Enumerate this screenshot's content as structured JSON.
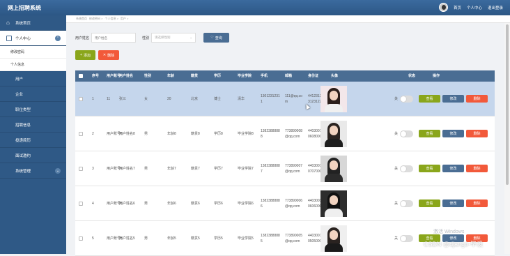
{
  "app": {
    "title": "网上招聘系统"
  },
  "topbar": {
    "avatar": "user-avatar",
    "links": [
      "首页",
      "个人中心",
      "退出登录"
    ]
  },
  "sidebar": {
    "items": [
      {
        "label": "系统首页",
        "icon": "home-icon",
        "type": "main"
      },
      {
        "label": "个人中心",
        "icon": "user-card-icon",
        "type": "main-light",
        "expanded": true
      },
      {
        "label": "修改密码",
        "type": "sub"
      },
      {
        "label": "个人信息",
        "type": "sub"
      },
      {
        "label": "用户",
        "icon": "grid-icon",
        "type": "main"
      },
      {
        "label": "企业",
        "icon": "grid-icon",
        "type": "main"
      },
      {
        "label": "职位类型",
        "icon": "grid-icon",
        "type": "main"
      },
      {
        "label": "招聘信息",
        "icon": "grid-icon",
        "type": "main"
      },
      {
        "label": "投递简历",
        "icon": "grid-icon",
        "type": "main"
      },
      {
        "label": "面试邀约",
        "icon": "grid-icon",
        "type": "main"
      },
      {
        "label": "系统管理",
        "icon": "grid-icon",
        "type": "main",
        "collapsible": true
      }
    ]
  },
  "breadcrumb": [
    "系统首页",
    "修改密码 >",
    "个人信息 >",
    "用户 >"
  ],
  "search": {
    "account_label": "用户姓名",
    "account_placeholder": "用户姓名",
    "gender_label": "性别",
    "gender_placeholder": "请选择性别",
    "button": "查询"
  },
  "actions": {
    "add": "添加",
    "delete": "删除"
  },
  "table": {
    "headers": [
      "序号",
      "用户账号",
      "用户姓名",
      "性别",
      "年龄",
      "籍贯",
      "学历",
      "毕业学院",
      "手机",
      "邮箱",
      "身份证",
      "头像",
      "状态",
      "操作"
    ],
    "status_label": "关",
    "buttons": {
      "view": "查看",
      "edit": "修改",
      "delete": "删除"
    },
    "rows": [
      {
        "no": "1",
        "account": "11",
        "name": "张三",
        "gender": "女",
        "age": "20",
        "origin": "北京",
        "edu": "博士",
        "school": "清华",
        "phone": "13012312311",
        "email": "111@qq.com",
        "idcard": "441231231231231223",
        "bg": "#f3e7ea",
        "hair": "#2b1e1a",
        "body": "#f0f0f0",
        "selected": true
      },
      {
        "no": "2",
        "account": "用户账号8",
        "name": "用户姓名8",
        "gender": "男",
        "age": "年龄8",
        "origin": "籍贯8",
        "edu": "学历8",
        "school": "毕业学院8",
        "phone": "13823888888",
        "email": "773890008@qq.com",
        "idcard": "440300199606080008",
        "bg": "#e9e9e9",
        "hair": "#2a2320",
        "body": "#1e1e1e",
        "selected": false
      },
      {
        "no": "3",
        "account": "用户账号7",
        "name": "用户姓名7",
        "gender": "男",
        "age": "年龄7",
        "origin": "籍贯7",
        "edu": "学历7",
        "school": "毕业学院7",
        "phone": "13823888887",
        "email": "773890007@qq.com",
        "idcard": "440300199707070007",
        "bg": "#d7d7d7",
        "hair": "#222",
        "body": "#2b2b2b",
        "selected": false
      },
      {
        "no": "4",
        "account": "用户账号6",
        "name": "用户姓名6",
        "gender": "男",
        "age": "年龄6",
        "origin": "籍贯6",
        "edu": "学历6",
        "school": "毕业学院6",
        "phone": "13823888886",
        "email": "773890006@qq.com",
        "idcard": "440300199606060006",
        "bg": "#2d2d2d",
        "hair": "#111",
        "body": "#efefef",
        "selected": false
      },
      {
        "no": "5",
        "account": "用户账号5",
        "name": "用户姓名5",
        "gender": "男",
        "age": "年龄5",
        "origin": "籍贯5",
        "edu": "学历5",
        "school": "毕业学院5",
        "phone": "13823888885",
        "email": "773890005@qq.com",
        "idcard": "440300199505050005",
        "bg": "#efefef",
        "hair": "#2a2320",
        "body": "#1a1a1a",
        "selected": false
      }
    ]
  },
  "watermark": "激活 Windows",
  "csdn": "CSDN @django-毕设"
}
